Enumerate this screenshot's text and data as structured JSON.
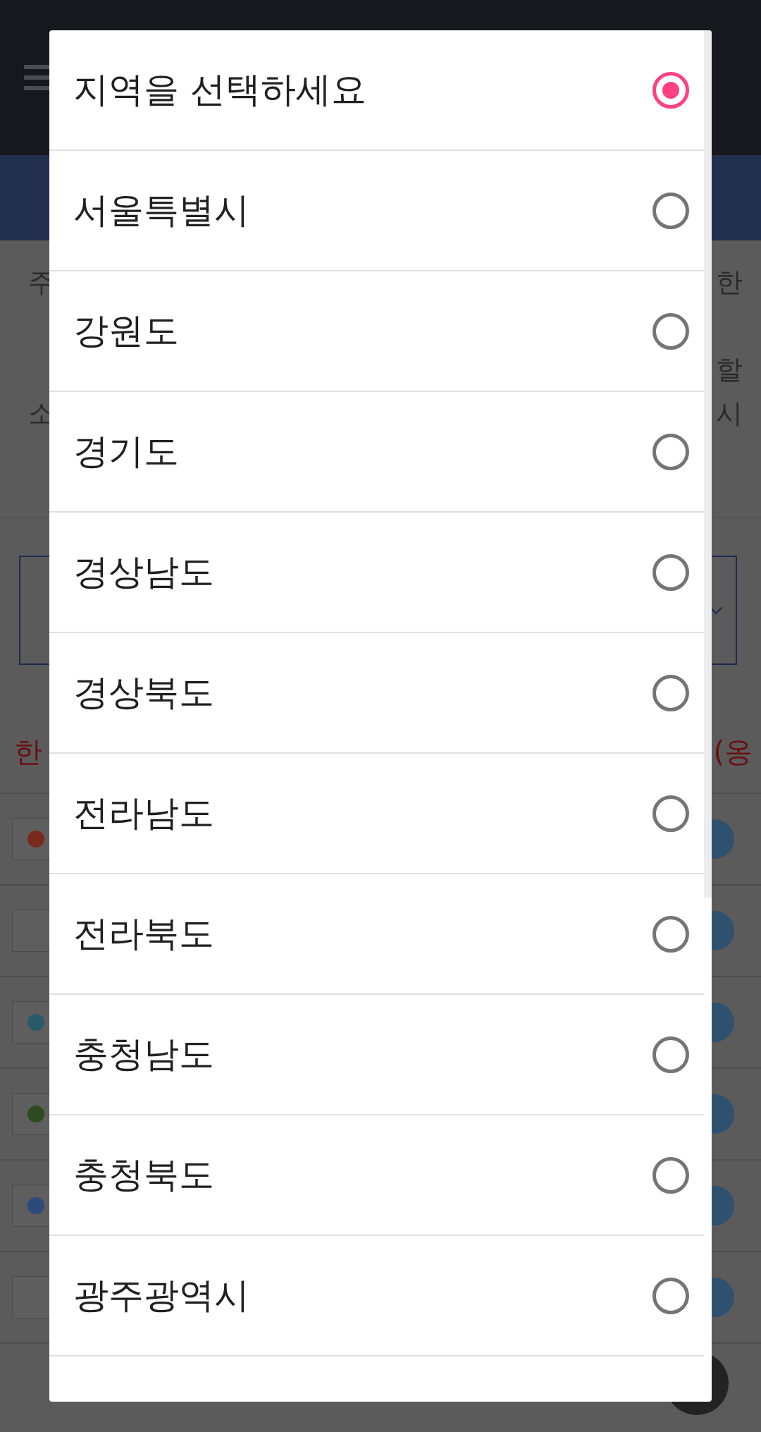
{
  "background": {
    "text_lines": [
      {
        "left": "주",
        "right": "한"
      },
      {
        "right": "할"
      },
      {
        "left": "소",
        "right": "시"
      }
    ],
    "notice_left": "한",
    "notice_right": "(옹"
  },
  "dialog": {
    "options": [
      {
        "label": "지역을 선택하세요",
        "selected": true
      },
      {
        "label": "서울특별시",
        "selected": false
      },
      {
        "label": "강원도",
        "selected": false
      },
      {
        "label": "경기도",
        "selected": false
      },
      {
        "label": "경상남도",
        "selected": false
      },
      {
        "label": "경상북도",
        "selected": false
      },
      {
        "label": "전라남도",
        "selected": false
      },
      {
        "label": "전라북도",
        "selected": false
      },
      {
        "label": "충청남도",
        "selected": false
      },
      {
        "label": "충청북도",
        "selected": false
      },
      {
        "label": "광주광역시",
        "selected": false
      }
    ]
  }
}
